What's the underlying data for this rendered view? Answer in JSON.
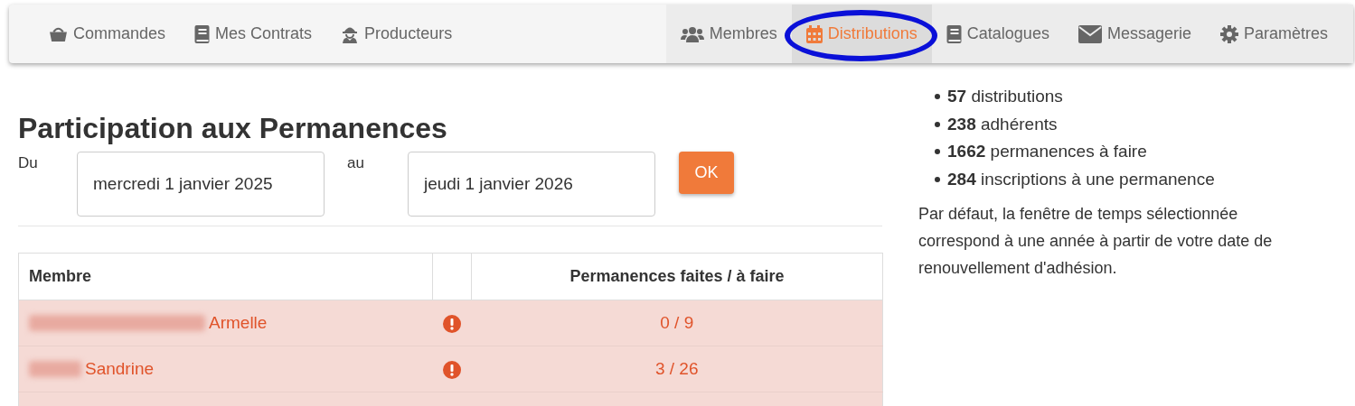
{
  "nav": {
    "left": [
      {
        "label": "Commandes",
        "selected": false,
        "circled": false
      },
      {
        "label": "Mes Contrats",
        "selected": false,
        "circled": false
      },
      {
        "label": "Producteurs",
        "selected": false,
        "circled": false
      }
    ],
    "right": [
      {
        "label": "Membres",
        "selected": false,
        "circled": false
      },
      {
        "label": "Distributions",
        "selected": true,
        "circled": true
      },
      {
        "label": "Catalogues",
        "selected": false,
        "circled": false
      },
      {
        "label": "Messagerie",
        "selected": false,
        "circled": false
      },
      {
        "label": "Paramètres",
        "selected": false,
        "circled": false
      }
    ]
  },
  "title": "Participation aux Permanences",
  "form": {
    "from_label": "Du",
    "from_value": "mercredi 1 janvier 2025",
    "to_label": "au",
    "to_value": "jeudi 1 janvier 2026",
    "submit": "OK"
  },
  "table": {
    "columns": [
      "Membre",
      "",
      "Permanences faites / à faire"
    ],
    "rows": [
      {
        "name": "Armelle",
        "redacted": true,
        "alert": true,
        "count": "0 / 9"
      },
      {
        "name": "Sandrine",
        "redacted": true,
        "alert": true,
        "count": "3 / 26"
      }
    ]
  },
  "stats": [
    "**57** distributions",
    "**238** adhérents",
    "**1662** permanences à faire",
    "**284** inscriptions à une permanence"
  ],
  "note": "Par défaut, la fenêtre de temps sélectionnée correspond à une année à partir de votre date de renouvellement d'adhésion."
}
